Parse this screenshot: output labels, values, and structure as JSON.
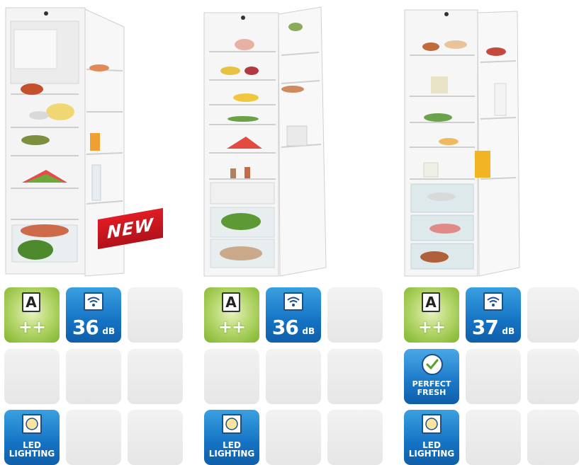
{
  "badge_new": "NEW",
  "products": [
    {
      "energy_class": "A",
      "energy_plus": "++",
      "noise_value": "36",
      "noise_unit": "dB",
      "led_label_1": "LED",
      "led_label_2": "LIGHTING"
    },
    {
      "energy_class": "A",
      "energy_plus": "++",
      "noise_value": "36",
      "noise_unit": "dB",
      "led_label_1": "LED",
      "led_label_2": "LIGHTING"
    },
    {
      "energy_class": "A",
      "energy_plus": "++",
      "noise_value": "37",
      "noise_unit": "dB",
      "perfect_fresh_1": "PERFECT",
      "perfect_fresh_2": "FRESH",
      "led_label_1": "LED",
      "led_label_2": "LIGHTING"
    }
  ],
  "colors": {
    "energy_green": "#7fb52c",
    "feature_blue": "#1573c4",
    "new_red": "#e01c24",
    "empty_tile": "#ececec"
  }
}
